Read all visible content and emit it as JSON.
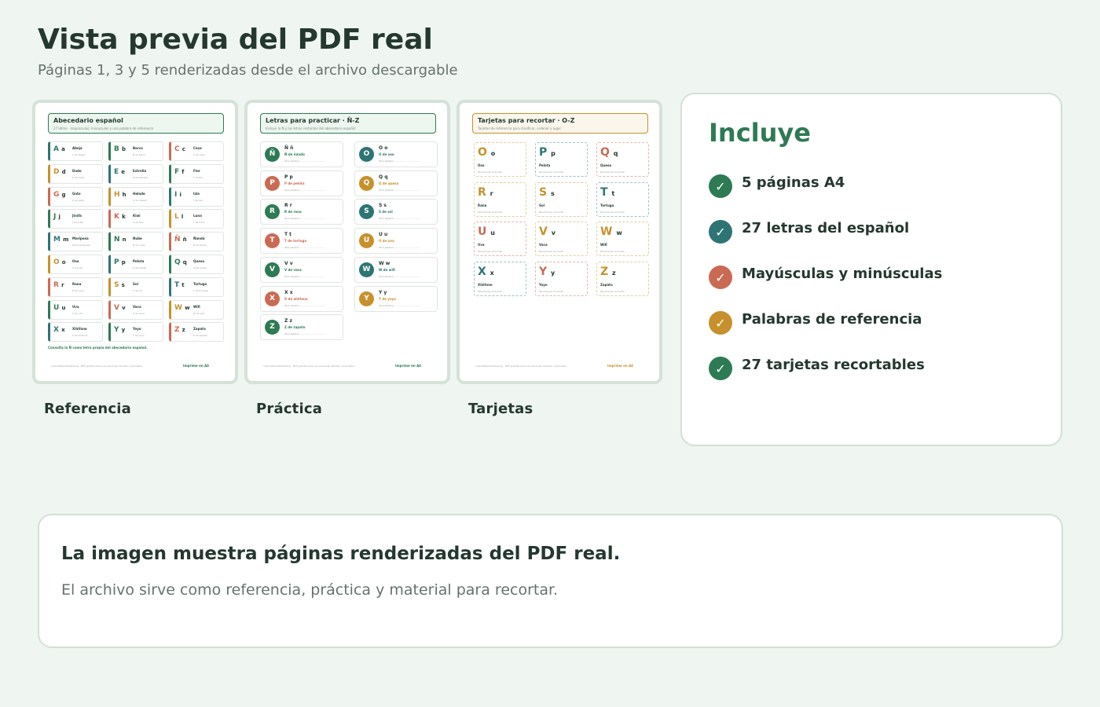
{
  "header": {
    "title": "Vista previa del PDF real",
    "subtitle": "Páginas 1, 3 y 5 renderizadas desde el archivo descargable"
  },
  "colors": {
    "green": "#2e7a55",
    "teal": "#2f7474",
    "red": "#c96a55",
    "gold": "#c6912c"
  },
  "thumbnails": [
    {
      "caption": "Referencia",
      "heading": "Abecedario español",
      "sub": "27 letras · mayúsculas, minúsculas y una palabra de referencia",
      "footer": "imprimibleinfantia.blog · PDF gratuito para uso personal, familiar o educativo",
      "footer_tag": "Imprime en A4",
      "note": "Consulta la Ñ como letra propia del abecedario español.",
      "cells": [
        {
          "up": "A",
          "lo": "a",
          "word": "Abeja",
          "hint": "A de abeja",
          "color": "teal"
        },
        {
          "up": "B",
          "lo": "b",
          "word": "Barco",
          "hint": "B de barco",
          "color": "green"
        },
        {
          "up": "C",
          "lo": "c",
          "word": "Casa",
          "hint": "C de casa",
          "color": "red"
        },
        {
          "up": "D",
          "lo": "d",
          "word": "Dado",
          "hint": "D de dado",
          "color": "gold"
        },
        {
          "up": "E",
          "lo": "e",
          "word": "Estrella",
          "hint": "E de estrella",
          "color": "teal"
        },
        {
          "up": "F",
          "lo": "f",
          "word": "Flor",
          "hint": "F de flor",
          "color": "green"
        },
        {
          "up": "G",
          "lo": "g",
          "word": "Gato",
          "hint": "G de gato",
          "color": "red"
        },
        {
          "up": "H",
          "lo": "h",
          "word": "Helado",
          "hint": "H de helado",
          "color": "gold"
        },
        {
          "up": "I",
          "lo": "i",
          "word": "Isla",
          "hint": "I de isla",
          "color": "teal"
        },
        {
          "up": "J",
          "lo": "j",
          "word": "Jirafa",
          "hint": "J de jirafa",
          "color": "green"
        },
        {
          "up": "K",
          "lo": "k",
          "word": "Kiwi",
          "hint": "K de kiwi",
          "color": "red"
        },
        {
          "up": "L",
          "lo": "l",
          "word": "Luna",
          "hint": "L de luna",
          "color": "gold"
        },
        {
          "up": "M",
          "lo": "m",
          "word": "Mariposa",
          "hint": "M de mariposa",
          "color": "teal"
        },
        {
          "up": "N",
          "lo": "n",
          "word": "Nube",
          "hint": "N de nube",
          "color": "green"
        },
        {
          "up": "Ñ",
          "lo": "ñ",
          "word": "Ñandú",
          "hint": "Ñ de ñandú",
          "color": "red"
        },
        {
          "up": "O",
          "lo": "o",
          "word": "Oso",
          "hint": "O de oso",
          "color": "gold"
        },
        {
          "up": "P",
          "lo": "p",
          "word": "Pelota",
          "hint": "P de pelota",
          "color": "teal"
        },
        {
          "up": "Q",
          "lo": "q",
          "word": "Queso",
          "hint": "Q de queso",
          "color": "green"
        },
        {
          "up": "R",
          "lo": "r",
          "word": "Rana",
          "hint": "R de rana",
          "color": "red"
        },
        {
          "up": "S",
          "lo": "s",
          "word": "Sol",
          "hint": "S de sol",
          "color": "gold"
        },
        {
          "up": "T",
          "lo": "t",
          "word": "Tortuga",
          "hint": "T de tortuga",
          "color": "teal"
        },
        {
          "up": "U",
          "lo": "u",
          "word": "Uva",
          "hint": "U de uva",
          "color": "green"
        },
        {
          "up": "V",
          "lo": "v",
          "word": "Vaca",
          "hint": "V de vaca",
          "color": "red"
        },
        {
          "up": "W",
          "lo": "w",
          "word": "Wifi",
          "hint": "W de wifi",
          "color": "gold"
        },
        {
          "up": "X",
          "lo": "x",
          "word": "Xilófono",
          "hint": "X de xilófono",
          "color": "teal"
        },
        {
          "up": "Y",
          "lo": "y",
          "word": "Yoyo",
          "hint": "Y de yoyo",
          "color": "green"
        },
        {
          "up": "Z",
          "lo": "z",
          "word": "Zapato",
          "hint": "Z de zapato",
          "color": "red"
        }
      ]
    },
    {
      "caption": "Práctica",
      "heading": "Letras para practicar · Ñ-Z",
      "sub": "Incluye la Ñ y las letras restantes del abecedario español",
      "footer": "imprimibleinfantia.blog · PDF gratuito para uso personal, familiar o educativo",
      "footer_tag": "Imprime en A4",
      "cells": [
        {
          "up": "Ñ",
          "pair": "Ñ ñ",
          "hint": "Ñ de ñandú",
          "extra": "Otra palabra",
          "color": "green"
        },
        {
          "up": "O",
          "pair": "O o",
          "hint": "O de oso",
          "extra": "Otra palabra",
          "color": "teal"
        },
        {
          "up": "P",
          "pair": "P p",
          "hint": "P de pelota",
          "extra": "Otra palabra",
          "color": "red"
        },
        {
          "up": "Q",
          "pair": "Q q",
          "hint": "Q de queso",
          "extra": "Otra palabra",
          "color": "gold"
        },
        {
          "up": "R",
          "pair": "R r",
          "hint": "R de rana",
          "extra": "Otra palabra",
          "color": "green"
        },
        {
          "up": "S",
          "pair": "S s",
          "hint": "S de sol",
          "extra": "Otra palabra",
          "color": "teal"
        },
        {
          "up": "T",
          "pair": "T t",
          "hint": "T de tortuga",
          "extra": "Otra palabra",
          "color": "red"
        },
        {
          "up": "U",
          "pair": "U u",
          "hint": "U de uva",
          "extra": "Otra palabra",
          "color": "gold"
        },
        {
          "up": "V",
          "pair": "V v",
          "hint": "V de vaca",
          "extra": "Otra palabra",
          "color": "green"
        },
        {
          "up": "W",
          "pair": "W w",
          "hint": "W de wifi",
          "extra": "Otra palabra",
          "color": "teal"
        },
        {
          "up": "X",
          "pair": "X x",
          "hint": "X de xilófono",
          "extra": "Otra palabra",
          "color": "red"
        },
        {
          "up": "Y",
          "pair": "Y y",
          "hint": "Y de yoyo",
          "extra": "Otra palabra",
          "color": "gold"
        },
        {
          "up": "Z",
          "pair": "Z z",
          "hint": "Z de zapato",
          "extra": "Otra palabra",
          "color": "green"
        }
      ]
    },
    {
      "caption": "Tarjetas",
      "heading": "Tarjetas para recortar · O-Z",
      "sub": "Tarjetas de referencia para clasificar, ordenar y jugar",
      "footer": "imprimibleinfantia.blog · PDF gratuito para uso personal, familiar o educativo",
      "footer_tag": "Imprime en A4",
      "cells": [
        {
          "up": "O",
          "lo": "o",
          "word": "Oso",
          "cut": "Recorta por el borde",
          "color": "gold"
        },
        {
          "up": "P",
          "lo": "p",
          "word": "Pelota",
          "cut": "Recorta por el borde",
          "color": "teal"
        },
        {
          "up": "Q",
          "lo": "q",
          "word": "Queso",
          "cut": "Recorta por el borde",
          "color": "red"
        },
        {
          "up": "R",
          "lo": "r",
          "word": "Rana",
          "cut": "Recorta por el borde",
          "color": "gold"
        },
        {
          "up": "S",
          "lo": "s",
          "word": "Sol",
          "cut": "Recorta por el borde",
          "color": "gold"
        },
        {
          "up": "T",
          "lo": "t",
          "word": "Tortuga",
          "cut": "Recorta por el borde",
          "color": "teal"
        },
        {
          "up": "U",
          "lo": "u",
          "word": "Uva",
          "cut": "Recorta por el borde",
          "color": "red"
        },
        {
          "up": "V",
          "lo": "v",
          "word": "Vaca",
          "cut": "Recorta por el borde",
          "color": "gold"
        },
        {
          "up": "W",
          "lo": "w",
          "word": "Wifi",
          "cut": "Recorta por el borde",
          "color": "gold"
        },
        {
          "up": "X",
          "lo": "x",
          "word": "Xilófono",
          "cut": "Recorta por el borde",
          "color": "teal"
        },
        {
          "up": "Y",
          "lo": "y",
          "word": "Yoyo",
          "cut": "Recorta por el borde",
          "color": "red"
        },
        {
          "up": "Z",
          "lo": "z",
          "word": "Zapato",
          "cut": "Recorta por el borde",
          "color": "gold"
        }
      ]
    }
  ],
  "includes": {
    "title": "Incluye",
    "items": [
      {
        "label": "5 páginas A4",
        "color": "green",
        "icon": "check-icon"
      },
      {
        "label": "27 letras del español",
        "color": "teal",
        "icon": "check-icon"
      },
      {
        "label": "Mayúsculas y minúsculas",
        "color": "red",
        "icon": "check-icon"
      },
      {
        "label": "Palabras de referencia",
        "color": "gold",
        "icon": "check-icon"
      },
      {
        "label": "27 tarjetas recortables",
        "color": "green",
        "icon": "check-icon"
      }
    ]
  },
  "note": {
    "title": "La imagen muestra páginas renderizadas del PDF real.",
    "text": "El archivo sirve como referencia, práctica y material para recortar."
  }
}
